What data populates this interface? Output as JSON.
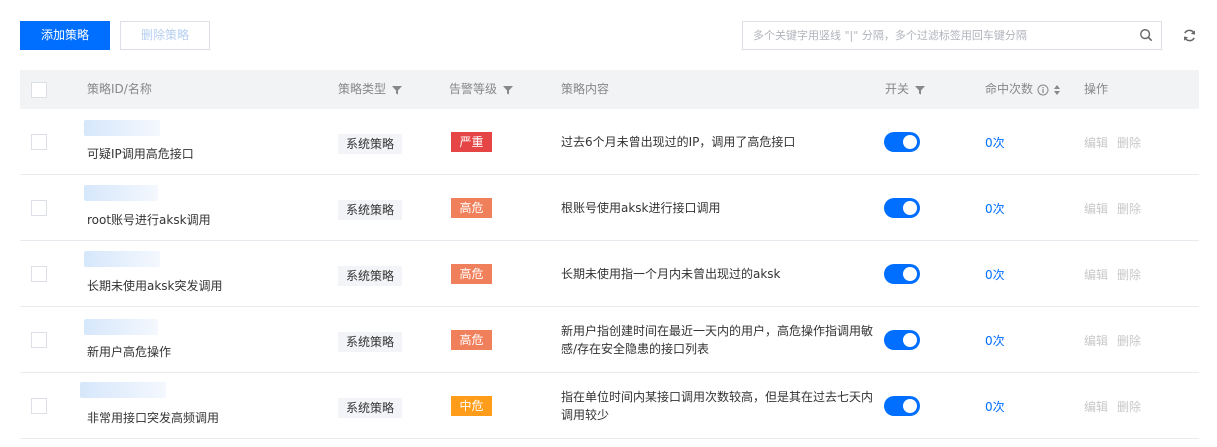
{
  "toolbar": {
    "add_label": "添加策略",
    "delete_label": "删除策略",
    "search_placeholder": "多个关键字用竖线 \"|\" 分隔，多个过滤标签用回车键分隔"
  },
  "table": {
    "headers": {
      "id_name": "策略ID/名称",
      "type": "策略类型",
      "level": "告警等级",
      "content": "策略内容",
      "switch": "开关",
      "hits": "命中次数",
      "actions": "操作"
    },
    "rows": [
      {
        "name": "可疑IP调用高危接口",
        "type": "系统策略",
        "level": "严重",
        "level_color": "#e54545",
        "content": "过去6个月未曾出现过的IP，调用了高危接口",
        "enabled": true,
        "hits": "0次",
        "edit": "编辑",
        "delete": "删除"
      },
      {
        "name": "root账号进行aksk调用",
        "type": "系统策略",
        "level": "高危",
        "level_color": "#f0805b",
        "content": "根账号使用aksk进行接口调用",
        "enabled": true,
        "hits": "0次",
        "edit": "编辑",
        "delete": "删除"
      },
      {
        "name": "长期未使用aksk突发调用",
        "type": "系统策略",
        "level": "高危",
        "level_color": "#f0805b",
        "content": "长期未使用指一个月内未曾出现过的aksk",
        "enabled": true,
        "hits": "0次",
        "edit": "编辑",
        "delete": "删除"
      },
      {
        "name": "新用户高危操作",
        "type": "系统策略",
        "level": "高危",
        "level_color": "#f0805b",
        "content": "新用户指创建时间在最近一天内的用户，高危操作指调用敏感/存在安全隐患的接口列表",
        "enabled": true,
        "hits": "0次",
        "edit": "编辑",
        "delete": "删除"
      },
      {
        "name": "非常用接口突发高频调用",
        "type": "系统策略",
        "level": "中危",
        "level_color": "#ff9c19",
        "content": "指在单位时间内某接口调用次数较高，但是其在过去七天内调用较少",
        "enabled": true,
        "hits": "0次",
        "edit": "编辑",
        "delete": "删除"
      }
    ]
  },
  "colors": {
    "primary": "#006eff",
    "critical": "#e54545",
    "high": "#f0805b",
    "medium": "#ff9c19"
  }
}
